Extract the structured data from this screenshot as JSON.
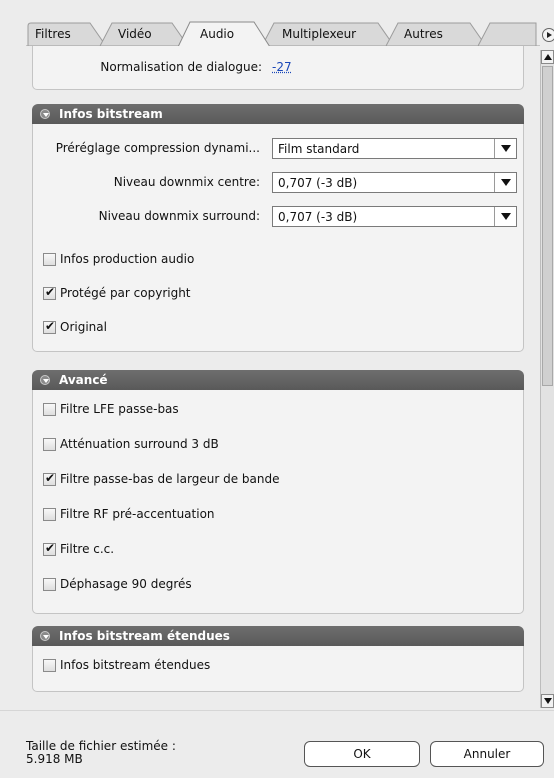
{
  "tabs": [
    {
      "label": "Filtres"
    },
    {
      "label": "Vidéo"
    },
    {
      "label": "Audio",
      "active": true
    },
    {
      "label": "Multiplexeur"
    },
    {
      "label": "Autres"
    }
  ],
  "top_row": {
    "label": "Normalisation de dialogue:",
    "value": "-27"
  },
  "bitstream": {
    "title": "Infos bitstream",
    "preset_label": "Préréglage compression dynami...",
    "preset_value": "Film standard",
    "center_label": "Niveau downmix centre:",
    "center_value": "0,707 (-3 dB)",
    "surround_label": "Niveau downmix surround:",
    "surround_value": "0,707 (-3 dB)",
    "checks": [
      {
        "label": "Infos production audio",
        "checked": false
      },
      {
        "label": "Protégé par copyright",
        "checked": true
      },
      {
        "label": "Original",
        "checked": true
      }
    ]
  },
  "advanced": {
    "title": "Avancé",
    "checks": [
      {
        "label": "Filtre LFE passe-bas",
        "checked": false
      },
      {
        "label": "Atténuation surround 3 dB",
        "checked": false
      },
      {
        "label": "Filtre passe-bas de largeur de bande",
        "checked": true
      },
      {
        "label": "Filtre RF pré-accentuation",
        "checked": false
      },
      {
        "label": "Filtre c.c.",
        "checked": true
      },
      {
        "label": "Déphasage 90 degrés",
        "checked": false
      }
    ]
  },
  "extended": {
    "title": "Infos bitstream étendues",
    "checks": [
      {
        "label": "Infos bitstream étendues",
        "checked": false
      }
    ]
  },
  "footer": {
    "size_label": "Taille de fichier estimée :",
    "size_value": "5.918 MB",
    "ok_label": "OK",
    "cancel_label": "Annuler"
  }
}
